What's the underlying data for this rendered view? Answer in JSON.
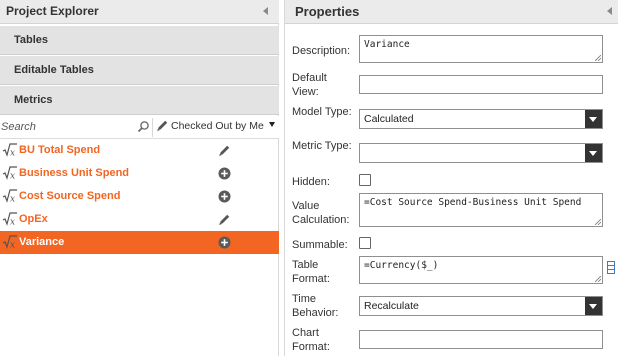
{
  "left_panel": {
    "title": "Project Explorer",
    "sections": [
      {
        "label": "Tables"
      },
      {
        "label": "Editable Tables"
      },
      {
        "label": "Metrics"
      }
    ],
    "search": {
      "placeholder": "Search",
      "value": ""
    },
    "filter": {
      "label": "Checked Out by Me"
    },
    "metrics": [
      {
        "name": "BU Total Spend",
        "status_icon": "pencil-icon",
        "selected": false
      },
      {
        "name": "Business Unit Spend",
        "status_icon": "plus-circle-icon",
        "selected": false
      },
      {
        "name": "Cost Source Spend",
        "status_icon": "plus-circle-icon",
        "selected": false
      },
      {
        "name": "OpEx",
        "status_icon": "pencil-icon",
        "selected": false
      },
      {
        "name": "Variance",
        "status_icon": "plus-circle-icon",
        "selected": true
      }
    ]
  },
  "properties": {
    "title": "Properties",
    "description": {
      "label": "Description:",
      "value": "Variance"
    },
    "default_view": {
      "label": "Default View:",
      "value": ""
    },
    "model_type": {
      "label": "Model Type:",
      "value": "Calculated"
    },
    "metric_type": {
      "label": "Metric Type:",
      "value": ""
    },
    "hidden": {
      "label": "Hidden:",
      "checked": false
    },
    "value_calculation": {
      "label": "Value Calculation:",
      "value": "=Cost Source Spend-Business Unit Spend"
    },
    "summable": {
      "label": "Summable:",
      "checked": false
    },
    "table_format": {
      "label": "Table Format:",
      "value": "=Currency($_)"
    },
    "time_behavior": {
      "label": "Time Behavior:",
      "value": "Recalculate"
    },
    "chart_format": {
      "label": "Chart Format:",
      "value": ""
    }
  },
  "colors": {
    "accent": "#f26522",
    "header_bg": "#ebebeb",
    "section_bg": "#e3e3e3",
    "select_button": "#333333"
  }
}
